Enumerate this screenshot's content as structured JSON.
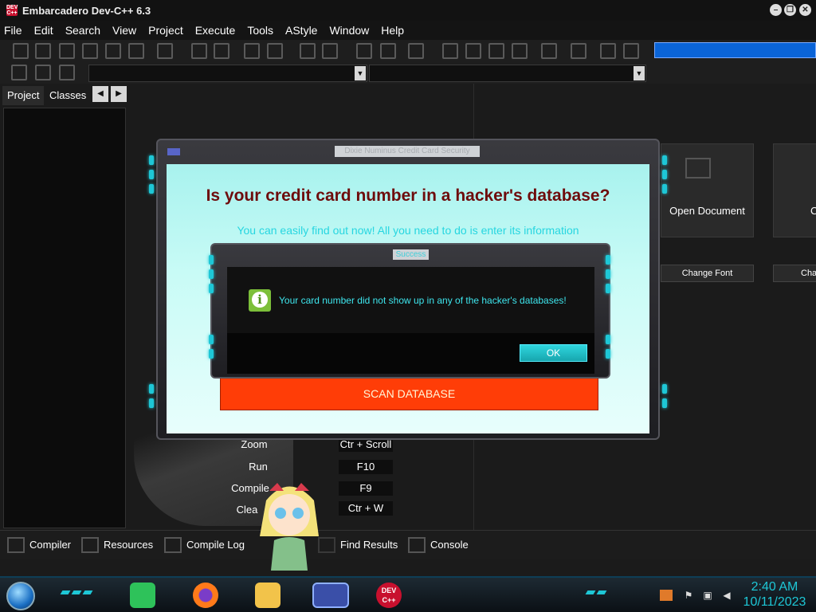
{
  "window": {
    "title": "Embarcadero Dev-C++ 6.3",
    "logo_text": "DEV C++"
  },
  "menu": [
    "File",
    "Edit",
    "Search",
    "View",
    "Project",
    "Execute",
    "Tools",
    "AStyle",
    "Window",
    "Help"
  ],
  "toolbar": {
    "search_value": ""
  },
  "left_panel": {
    "tabs": [
      "Project",
      "Classes"
    ],
    "nav_left": "◀",
    "nav_right": "▶"
  },
  "welcome": {
    "tiles": [
      "Open Document",
      "C"
    ],
    "buttons": [
      "Change Font",
      "Cha"
    ],
    "shortcuts": [
      {
        "label": "Zoom",
        "key": "Ctr + Scroll"
      },
      {
        "label": "Run",
        "key": "F10"
      },
      {
        "label": "Compile",
        "key": "F9"
      },
      {
        "label": "Clea",
        "key": "Ctr + W"
      }
    ]
  },
  "bottom_tabs": [
    "Compiler",
    "Resources",
    "Compile Log",
    "Find Results",
    "Console"
  ],
  "scam_dialog": {
    "title": "Dixie Numinus Credit Card Security",
    "heading": "Is your credit card number in a hacker's database?",
    "subheading": "You can easily find out now! All you need to do is enter its information",
    "scan_button": "SCAN DATABASE"
  },
  "success_dialog": {
    "title": "Success",
    "message": "Your card number did not show up in any of the hacker's databases!",
    "ok_button": "OK"
  },
  "taskbar": {
    "apps": [
      "notes-icon",
      "firefox-icon",
      "file-explorer-icon",
      "dialog-app-icon",
      "devcpp-icon"
    ],
    "devcpp_label": "DEV C++",
    "clock_time": "2:40 AM",
    "clock_date": "10/11/2023"
  },
  "colors": {
    "accent_cyan": "#1ec7d6",
    "scan_button": "#ff3d07",
    "heading_red": "#6e0c0c",
    "search_selection": "#0a64d8"
  }
}
